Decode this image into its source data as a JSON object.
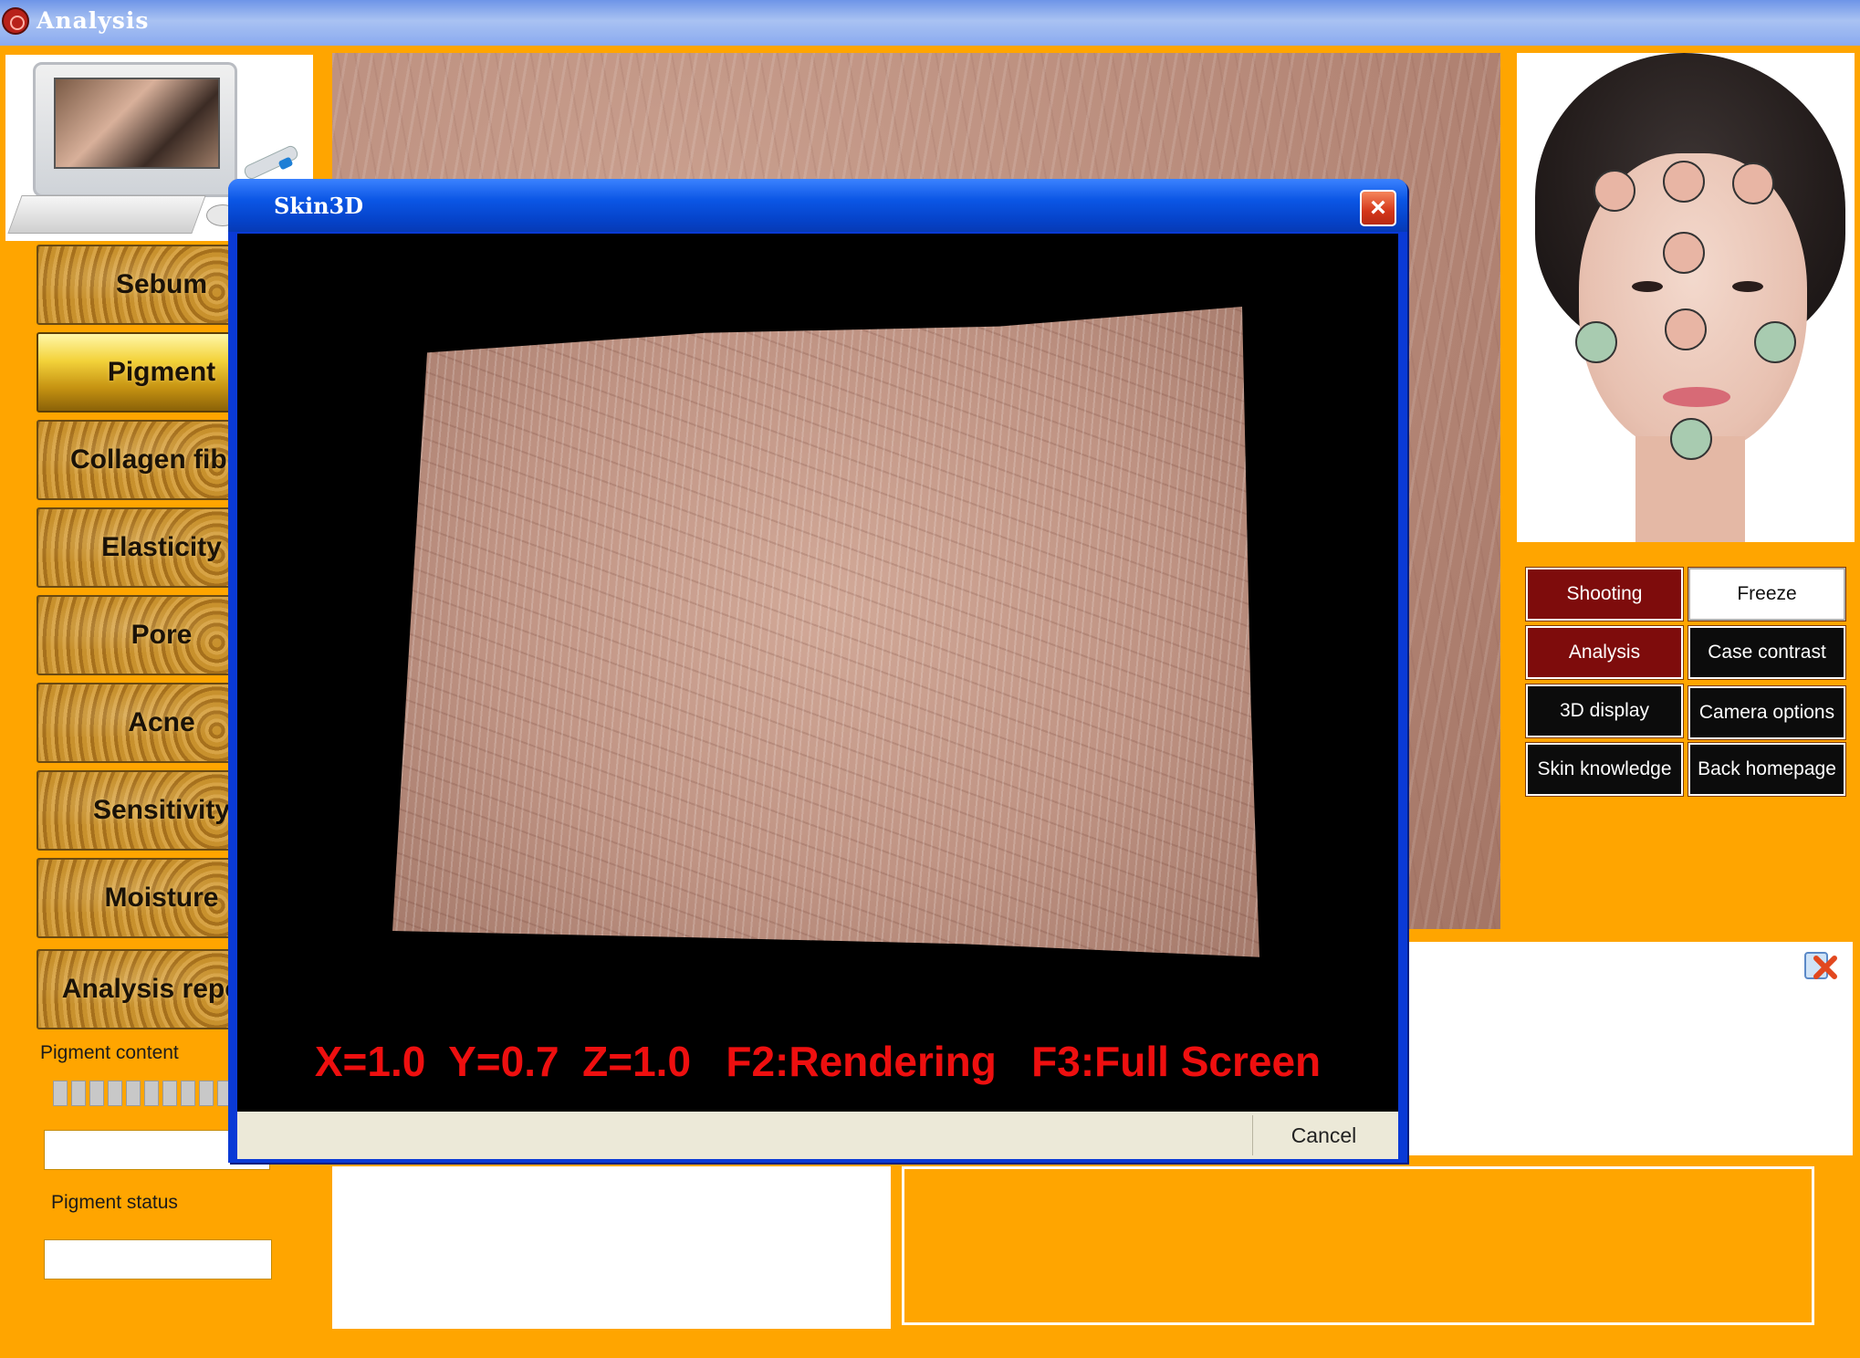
{
  "window": {
    "title": "Analysis"
  },
  "sidebar": {
    "items": [
      {
        "label": "Sebum"
      },
      {
        "label": "Pigment",
        "active": true
      },
      {
        "label": "Collagen fiber"
      },
      {
        "label": "Elasticity"
      },
      {
        "label": "Pore"
      },
      {
        "label": "Acne"
      },
      {
        "label": "Sensitivity"
      },
      {
        "label": "Moisture"
      },
      {
        "label": "Analysis report"
      }
    ],
    "pigment_content_label": "Pigment content",
    "pigment_content_value": "",
    "pigment_status_label": "Pigment status",
    "pigment_status_value": ""
  },
  "controls": {
    "buttons": [
      {
        "label": "Shooting",
        "style": "red"
      },
      {
        "label": "Freeze",
        "style": "white"
      },
      {
        "label": "Analysis",
        "style": "red"
      },
      {
        "label": "Case contrast",
        "style": "dark"
      },
      {
        "label": "3D display",
        "style": "dark"
      },
      {
        "label": "Camera options",
        "style": "dark"
      },
      {
        "label": "Skin knowledge",
        "style": "dark"
      },
      {
        "label": "Back homepage",
        "style": "dark"
      }
    ]
  },
  "dialog": {
    "title": "Skin3D",
    "readout": "X=1.0  Y=0.7  Z=1.0   F2:Rendering   F3:Full Screen",
    "cancel_label": "Cancel",
    "close_glyph": "×"
  },
  "icons": {
    "app": "app-logo-icon",
    "close": "close-icon",
    "report_close": "close-report-icon"
  },
  "colors": {
    "background": "#FFA500",
    "readout": "#EE0F0F",
    "point_pink": "#E8B5A4",
    "point_green": "#A8CBB0",
    "button_red": "#7E0C0C"
  }
}
